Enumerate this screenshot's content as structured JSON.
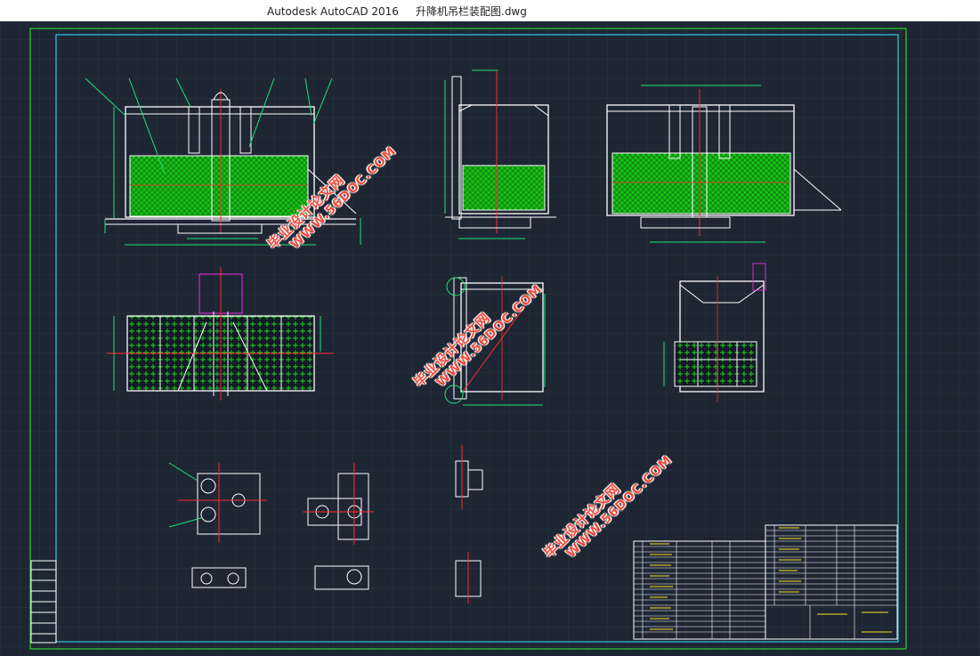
{
  "window": {
    "app_title": "Autodesk AutoCAD 2016",
    "file_name": "升降机吊栏装配图.dwg"
  },
  "watermark": {
    "text_cn": "毕业设计论文网",
    "text_url": "WWW.56DOC.COM"
  },
  "colors": {
    "background": "#1e2633",
    "frame_outer": "#2fd12f",
    "frame_inner": "#2ec7e8",
    "geometry": "#ffffff",
    "mesh": "#22d522",
    "centerline": "#ff2b2b",
    "dimension": "#22e07a",
    "magenta": "#d02ad0",
    "watermark": "#f04c3c"
  }
}
